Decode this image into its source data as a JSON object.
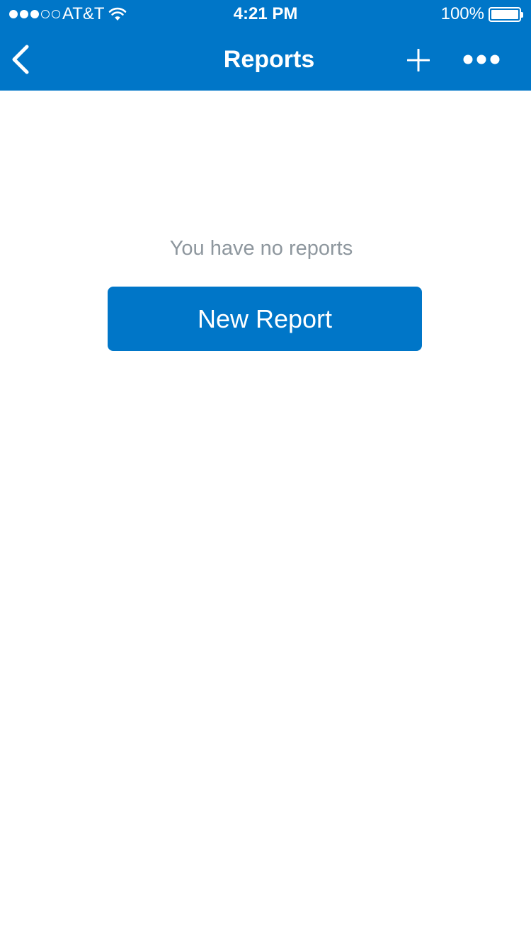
{
  "colors": {
    "accent": "#0076c8",
    "empty_text": "#8e979e",
    "background": "#ffffff"
  },
  "status_bar": {
    "signal_strength": 3,
    "signal_max": 5,
    "carrier": "AT&T",
    "time": "4:21 PM",
    "battery_percent": "100%",
    "battery_level": 1.0
  },
  "nav": {
    "title": "Reports",
    "back_icon": "chevron-left-icon",
    "add_icon": "plus-icon",
    "more_icon": "ellipsis-icon"
  },
  "empty_state": {
    "message": "You have no reports",
    "button_label": "New Report"
  }
}
